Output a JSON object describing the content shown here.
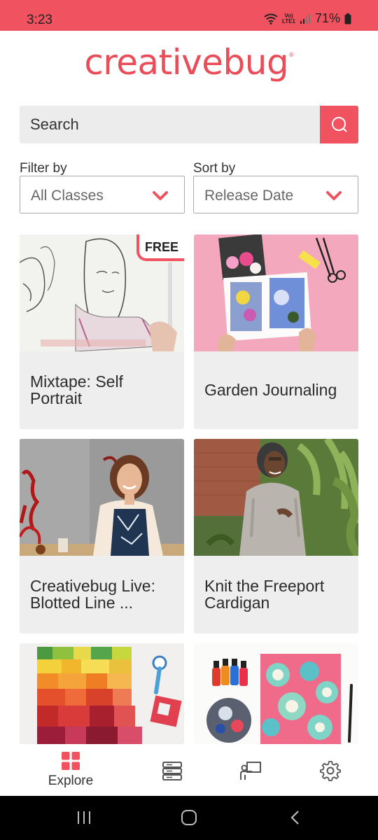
{
  "status": {
    "time": "3:23",
    "lte_top": "Vo)",
    "lte_bottom": "LTE1",
    "battery": "71%"
  },
  "app": {
    "logo": "creativebug",
    "logo_mark": "®"
  },
  "search": {
    "placeholder": "Search"
  },
  "filter": {
    "label": "Filter by",
    "value": "All Classes"
  },
  "sort": {
    "label": "Sort by",
    "value": "Release Date"
  },
  "cards": [
    {
      "title": "Mixtape: Self Portrait",
      "badge": "FREE"
    },
    {
      "title": "Garden Journaling"
    },
    {
      "title": "Creativebug Live: Blotted Line ..."
    },
    {
      "title": "Knit the Freeport Cardigan"
    },
    {
      "title": ""
    },
    {
      "title": ""
    }
  ],
  "nav": {
    "explore_label": "Explore"
  },
  "colors": {
    "brand": "#f0525f",
    "logo": "#ea4d58"
  }
}
